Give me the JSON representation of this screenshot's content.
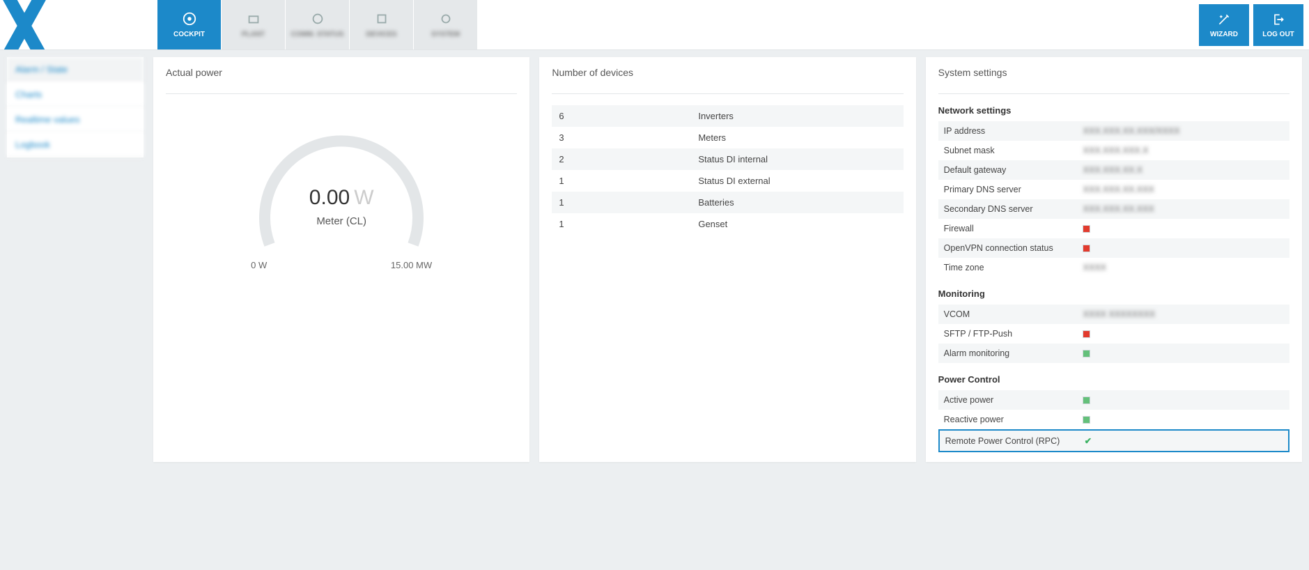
{
  "nav": {
    "active": "COCKPIT",
    "items": [
      "COCKPIT",
      "PLANT",
      "COMM. STATUS",
      "DEVICES",
      "SYSTEM"
    ]
  },
  "top_actions": {
    "wizard": "WIZARD",
    "logout": "LOG OUT"
  },
  "sidebar": {
    "items": [
      "Alarm / State",
      "Charts",
      "Realtime values",
      "Logbook"
    ]
  },
  "gauge_panel": {
    "title": "Actual power",
    "value": "0.00",
    "unit": "W",
    "subtitle": "Meter (CL)",
    "min": "0 W",
    "max": "15.00 MW"
  },
  "devices_panel": {
    "title": "Number of devices",
    "rows": [
      {
        "count": "6",
        "label": "Inverters"
      },
      {
        "count": "3",
        "label": "Meters"
      },
      {
        "count": "2",
        "label": "Status DI internal"
      },
      {
        "count": "1",
        "label": "Status DI external"
      },
      {
        "count": "1",
        "label": "Batteries"
      },
      {
        "count": "1",
        "label": "Genset"
      }
    ]
  },
  "settings_panel": {
    "title": "System settings",
    "network_title": "Network settings",
    "monitoring_title": "Monitoring",
    "power_title": "Power Control",
    "network": [
      {
        "label": "IP address",
        "value": "XXX.XXX.XX.XXX/XXXX",
        "blur": true
      },
      {
        "label": "Subnet mask",
        "value": "XXX.XXX.XXX.X",
        "blur": true
      },
      {
        "label": "Default gateway",
        "value": "XXX.XXX.XX.X",
        "blur": true
      },
      {
        "label": "Primary DNS server",
        "value": "XXX.XXX.XX.XXX",
        "blur": true
      },
      {
        "label": "Secondary DNS server",
        "value": "XXX.XXX.XX.XXX",
        "blur": true
      },
      {
        "label": "Firewall",
        "status": "red"
      },
      {
        "label": "OpenVPN connection status",
        "status": "red"
      },
      {
        "label": "Time zone",
        "value": "XXXX",
        "blur": true
      }
    ],
    "monitoring": [
      {
        "label": "VCOM",
        "value": "XXXX XXXXXXXX",
        "blur": true
      },
      {
        "label": "SFTP / FTP-Push",
        "status": "red"
      },
      {
        "label": "Alarm monitoring",
        "status": "green"
      }
    ],
    "power": [
      {
        "label": "Active power",
        "status": "green"
      },
      {
        "label": "Reactive power",
        "status": "green"
      },
      {
        "label": "Remote Power Control (RPC)",
        "check": true,
        "highlight": true
      }
    ]
  }
}
